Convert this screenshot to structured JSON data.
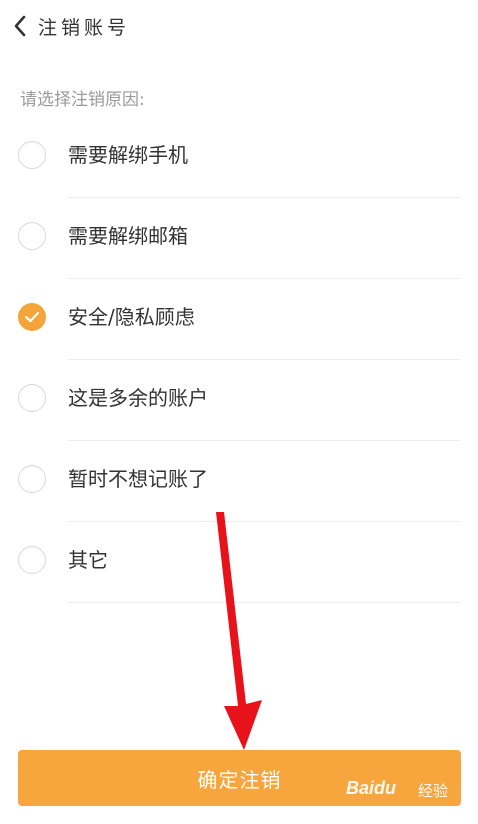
{
  "header": {
    "title": "注销账号"
  },
  "prompt": "请选择注销原因:",
  "options": [
    {
      "label": "需要解绑手机",
      "checked": false
    },
    {
      "label": "需要解绑邮箱",
      "checked": false
    },
    {
      "label": "安全/隐私顾虑",
      "checked": true
    },
    {
      "label": "这是多余的账户",
      "checked": false
    },
    {
      "label": "暂时不想记账了",
      "checked": false
    },
    {
      "label": "其它",
      "checked": false
    }
  ],
  "confirm_label": "确定注销",
  "watermark": {
    "brand": "Baidu",
    "suffix": "经验"
  },
  "colors": {
    "accent": "#f7a63d",
    "arrow": "#e8121b"
  },
  "icons": {
    "back": "chevron-left-icon",
    "check": "check-icon"
  }
}
